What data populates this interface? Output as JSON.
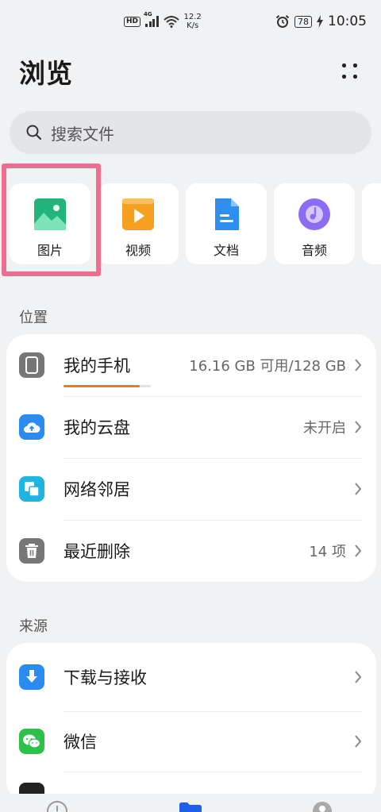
{
  "status": {
    "net_type": "4G",
    "net_speed_value": "12.2",
    "net_speed_unit": "K/s",
    "battery": "78",
    "time": "10:05"
  },
  "header": {
    "title": "浏览"
  },
  "search": {
    "placeholder": "搜索文件"
  },
  "categories": [
    {
      "label": "图片",
      "icon": "image-icon",
      "color": "#22b47a"
    },
    {
      "label": "视频",
      "icon": "video-icon",
      "color": "#f6a020"
    },
    {
      "label": "文档",
      "icon": "document-icon",
      "color": "#2e8ff0"
    },
    {
      "label": "音频",
      "icon": "audio-icon",
      "color": "#8c6cf2"
    }
  ],
  "locations": {
    "title": "位置",
    "items": [
      {
        "label": "我的手机",
        "value": "16.16 GB 可用/128 GB",
        "icon": "phone-icon",
        "color": "#777777",
        "usage_fraction": 0.87
      },
      {
        "label": "我的云盘",
        "value": "未开启",
        "icon": "cloud-drive-icon",
        "color": "#2a8bf0"
      },
      {
        "label": "网络邻居",
        "value": "",
        "icon": "network-neighborhood-icon",
        "color": "#1fb4e2"
      },
      {
        "label": "最近删除",
        "value": "14 项",
        "icon": "trash-icon",
        "color": "#777777"
      }
    ]
  },
  "sources": {
    "title": "来源",
    "items": [
      {
        "label": "下载与接收",
        "icon": "download-icon",
        "color": "#2a8bf0"
      },
      {
        "label": "微信",
        "icon": "wechat-icon",
        "color": "#2ec14a"
      }
    ]
  },
  "tab_bar": {
    "active_color": "#1f5ee6"
  }
}
